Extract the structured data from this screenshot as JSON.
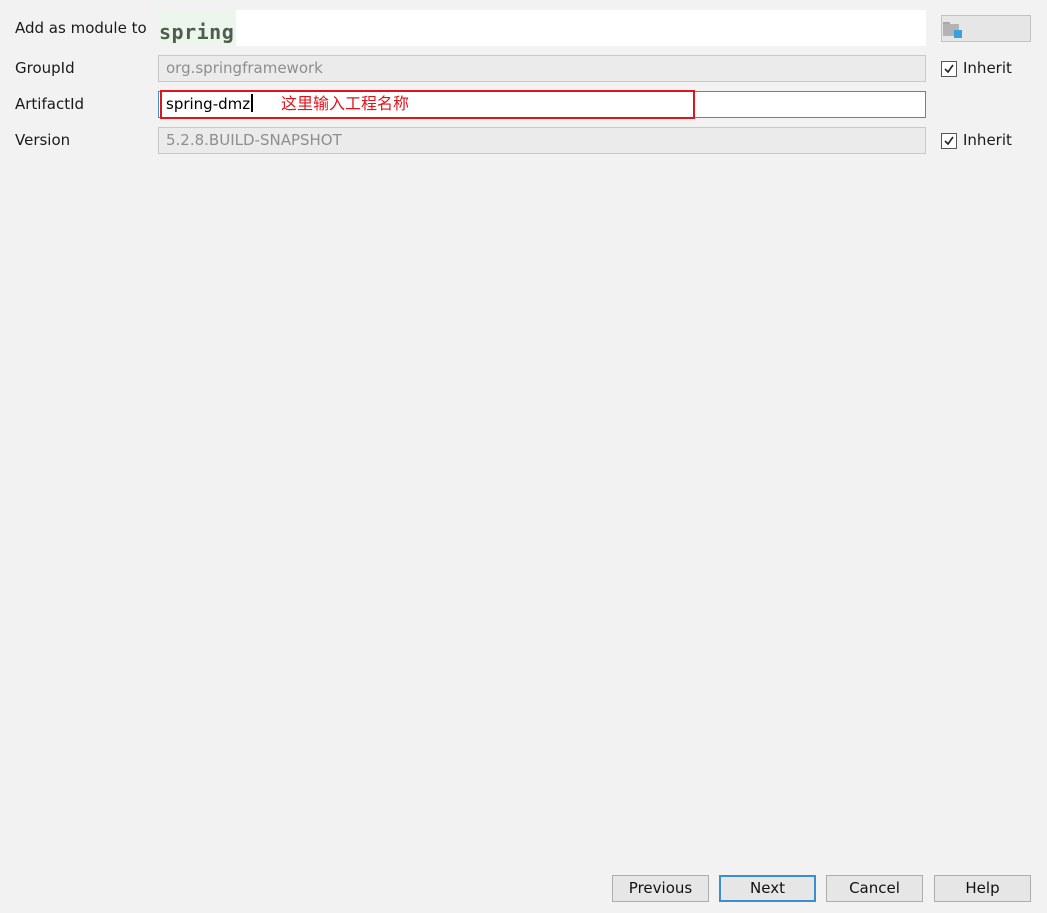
{
  "form": {
    "module": {
      "label": "Add as module to",
      "value": "spring"
    },
    "group_id": {
      "label": "GroupId",
      "value": "org.springframework",
      "inherit_label": "Inherit",
      "inherit_checked": true
    },
    "artifact_id": {
      "label": "ArtifactId",
      "value": "spring-dmz"
    },
    "version": {
      "label": "Version",
      "value": "5.2.8.BUILD-SNAPSHOT",
      "inherit_label": "Inherit",
      "inherit_checked": true
    }
  },
  "annotation": {
    "text": "这里输入工程名称",
    "color": "#e0141c"
  },
  "buttons": {
    "previous": "Previous",
    "next": "Next",
    "cancel": "Cancel",
    "help": "Help"
  },
  "icons": {
    "browse": "folder-icon",
    "checkbox": "check-icon"
  },
  "colors": {
    "background": "#f2f2f2",
    "focus_border": "#3d8fd1",
    "module_highlight": "#ecf6ec"
  }
}
